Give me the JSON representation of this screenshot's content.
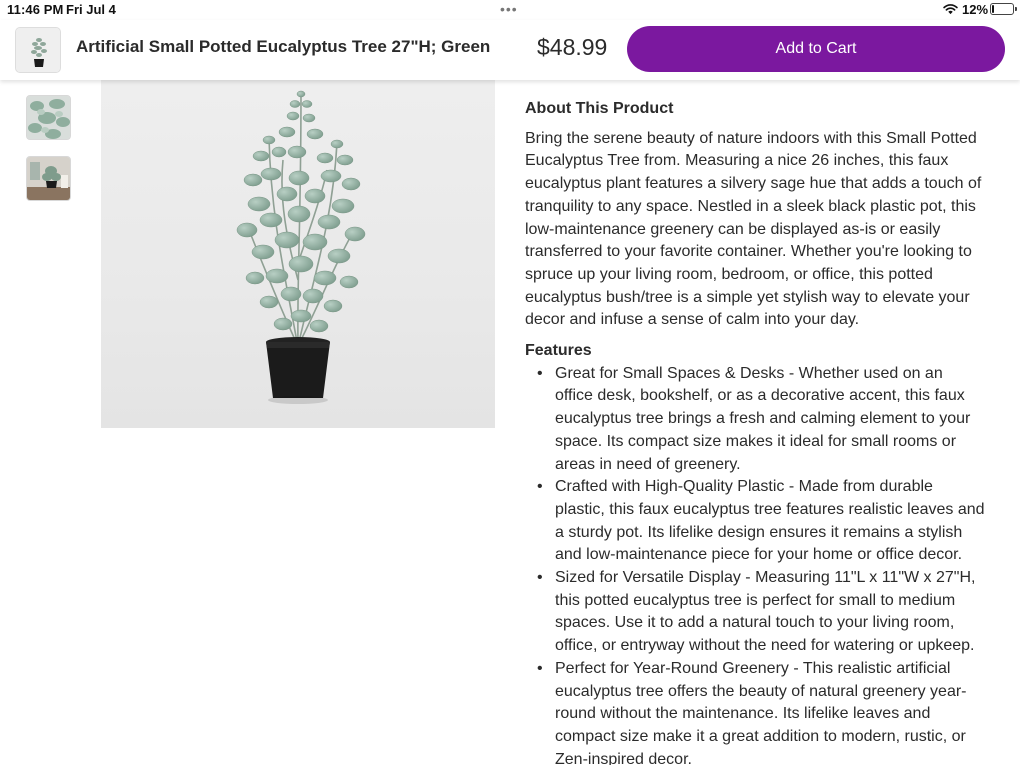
{
  "status_bar": {
    "time": "11:46 PM",
    "date": "Fri Jul 4",
    "battery_percent": "12%",
    "battery_level": 0.12,
    "icons": [
      "wifi-icon",
      "battery-icon",
      "more-dots-icon"
    ]
  },
  "header": {
    "title": "Artificial Small Potted Eucalyptus Tree 27\"H; Green",
    "price": "$48.99",
    "add_to_cart_label": "Add to Cart",
    "accent_color": "#7b189f"
  },
  "gallery": {
    "thumbnail_count": 2,
    "selected_index": 0
  },
  "about": {
    "heading": "About This Product",
    "body": "Bring the serene beauty of nature indoors with this Small Potted Eucalyptus Tree from. Measuring a nice 26 inches, this faux eucalyptus plant features a silvery sage hue that adds a touch of tranquility to any space. Nestled in a sleek black plastic pot, this low-maintenance greenery can be displayed as-is or easily transferred to your favorite container. Whether you're looking to spruce up your living room, bedroom, or office, this potted eucalyptus bush/tree is a simple yet stylish way to elevate your decor and infuse a sense of calm into your day."
  },
  "features": {
    "heading": "Features",
    "items": [
      "Great for Small Spaces & Desks - Whether used on an office desk, bookshelf, or as a decorative accent, this faux eucalyptus tree brings a fresh and calming element to your space. Its compact size makes it ideal for small rooms or areas in need of greenery.",
      "Crafted with High-Quality Plastic - Made from durable plastic, this faux eucalyptus tree features realistic leaves and a sturdy pot. Its lifelike design ensures it remains a stylish and low-maintenance piece for your home or office decor.",
      "Sized for Versatile Display - Measuring 11\"L x 11\"W x 27\"H, this potted eucalyptus tree is perfect for small to medium spaces. Use it to add a natural touch to your living room, office, or entryway without the need for watering or upkeep.",
      "Perfect for Year-Round Greenery - This realistic artificial eucalyptus tree offers the beauty of natural greenery year-round without the maintenance. Its lifelike leaves and compact size make it a great addition to modern, rustic, or Zen-inspired decor."
    ]
  }
}
